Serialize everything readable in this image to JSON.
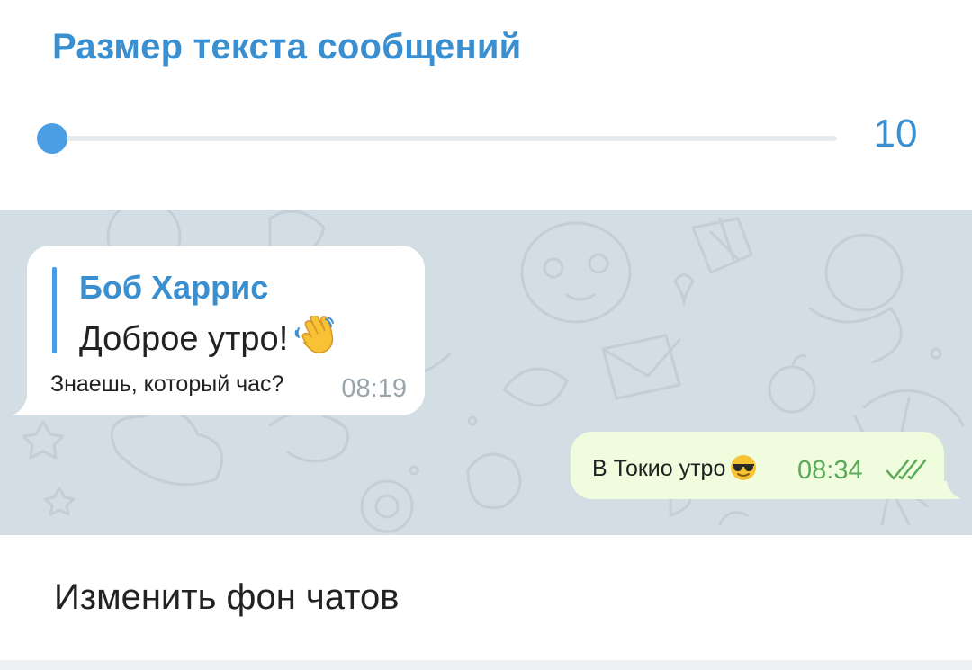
{
  "text_size": {
    "title": "Размер текста сообщений",
    "value": "10",
    "slider_fraction": 0.0
  },
  "chat_preview": {
    "incoming": {
      "reply_author": "Боб Харрис",
      "reply_text": "Доброе утро!",
      "reply_emoji": "waving-hand-icon",
      "text": "Знаешь, который час?",
      "time": "08:19"
    },
    "outgoing": {
      "text": "В Токио утро",
      "emoji": "sunglasses-face-icon",
      "time": "08:34",
      "status": "read-double-check-icon"
    }
  },
  "menu": {
    "change_background": "Изменить фон чатов"
  },
  "colors": {
    "accent": "#3a8fd0",
    "slider": "#4a9ee4",
    "chat_background": "#d3dde4",
    "outgoing_bubble": "#effdde",
    "outgoing_time": "#5ca95a"
  }
}
